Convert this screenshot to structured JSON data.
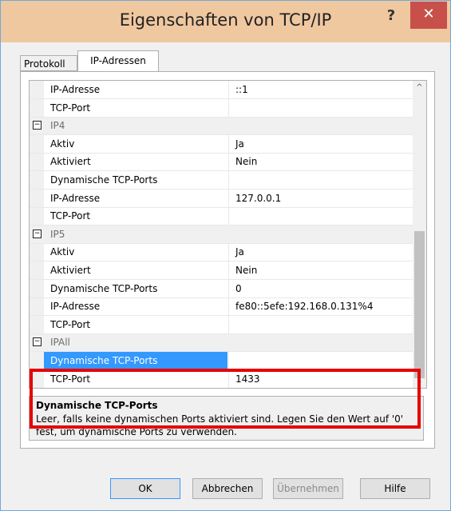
{
  "window": {
    "title": "Eigenschaften von TCP/IP",
    "help_symbol": "?",
    "close_symbol": "✕"
  },
  "tabs": [
    {
      "label": "Protokoll"
    },
    {
      "label": "IP-Adressen"
    }
  ],
  "grid": {
    "rows": [
      {
        "type": "prop",
        "name": "IP-Adresse",
        "value": "::1"
      },
      {
        "type": "prop",
        "name": "TCP-Port",
        "value": ""
      },
      {
        "type": "cat",
        "name": "IP4",
        "toggle": "−"
      },
      {
        "type": "prop",
        "name": "Aktiv",
        "value": "Ja"
      },
      {
        "type": "prop",
        "name": "Aktiviert",
        "value": "Nein"
      },
      {
        "type": "prop",
        "name": "Dynamische TCP-Ports",
        "value": ""
      },
      {
        "type": "prop",
        "name": "IP-Adresse",
        "value": "127.0.0.1"
      },
      {
        "type": "prop",
        "name": "TCP-Port",
        "value": ""
      },
      {
        "type": "cat",
        "name": "IP5",
        "toggle": "−"
      },
      {
        "type": "prop",
        "name": "Aktiv",
        "value": "Ja"
      },
      {
        "type": "prop",
        "name": "Aktiviert",
        "value": "Nein"
      },
      {
        "type": "prop",
        "name": "Dynamische TCP-Ports",
        "value": "0"
      },
      {
        "type": "prop",
        "name": "IP-Adresse",
        "value": "fe80::5efe:192.168.0.131%4"
      },
      {
        "type": "prop",
        "name": "TCP-Port",
        "value": ""
      },
      {
        "type": "cat",
        "name": "IPAll",
        "toggle": "−"
      },
      {
        "type": "prop",
        "name": "Dynamische TCP-Ports",
        "value": "",
        "selected": true
      },
      {
        "type": "prop",
        "name": "TCP-Port",
        "value": "1433"
      }
    ],
    "scroll_up": "^",
    "scroll_down": "⌄"
  },
  "description": {
    "title": "Dynamische TCP-Ports",
    "text": "Leer, falls keine dynamischen Ports aktiviert sind. Legen Sie den Wert auf '0' fest, um dynamische Ports zu verwenden."
  },
  "buttons": {
    "ok": "OK",
    "cancel": "Abbrechen",
    "apply": "Übernehmen",
    "help": "Hilfe"
  }
}
